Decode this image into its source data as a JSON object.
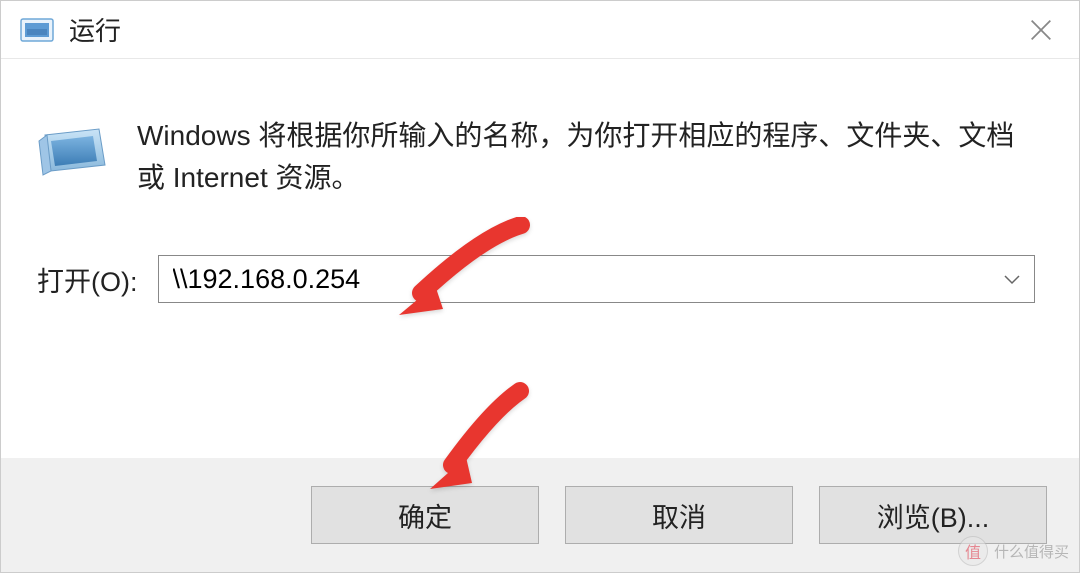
{
  "window": {
    "title": "运行"
  },
  "description": "Windows 将根据你所输入的名称，为你打开相应的程序、文件夹、文档或 Internet 资源。",
  "input": {
    "label": "打开(O):",
    "value": "\\\\192.168.0.254"
  },
  "buttons": {
    "ok": "确定",
    "cancel": "取消",
    "browse": "浏览(B)..."
  },
  "watermark": {
    "badge": "值",
    "text": "什么值得买"
  }
}
